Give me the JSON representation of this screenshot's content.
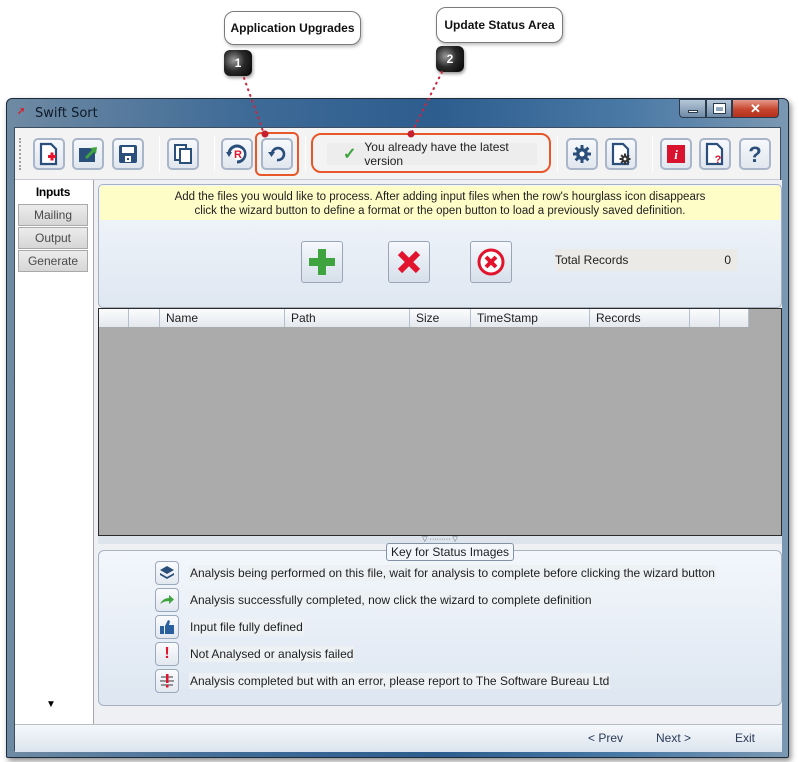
{
  "callouts": [
    {
      "number": "1",
      "label": "Application Upgrades"
    },
    {
      "number": "2",
      "label": "Update Status Area"
    }
  ],
  "window": {
    "title": "Swift Sort",
    "controls": {
      "minimize": "minimize",
      "maximize": "maximize",
      "close": "✕"
    }
  },
  "toolbar": {
    "buttons": [
      {
        "name": "new-definition",
        "icon": "new-file-icon"
      },
      {
        "name": "open-definition",
        "icon": "open-folder-icon"
      },
      {
        "name": "save-definition",
        "icon": "save-icon"
      },
      {
        "name": "copy",
        "icon": "copy-icon"
      },
      {
        "name": "register",
        "icon": "register-icon"
      },
      {
        "name": "check-upgrades",
        "icon": "refresh-icon"
      },
      {
        "name": "settings",
        "icon": "gear-icon"
      },
      {
        "name": "file-settings",
        "icon": "file-gear-icon"
      },
      {
        "name": "info",
        "icon": "info-icon"
      },
      {
        "name": "file-help",
        "icon": "file-question-icon"
      },
      {
        "name": "help",
        "icon": "help-icon"
      }
    ],
    "status_message": "You already have the latest version",
    "status_icon": "✓"
  },
  "tabs": [
    {
      "label": "Inputs",
      "active": true
    },
    {
      "label": "Mailing",
      "active": false
    },
    {
      "label": "Output",
      "active": false
    },
    {
      "label": "Generate",
      "active": false
    }
  ],
  "tabs_scroll_glyph": "▼",
  "inputs": {
    "instructions_line1": "Add the files you would like to process.  After adding input files when the row's hourglass icon disappears",
    "instructions_line2": "click the wizard button to define a format or the open button to load a previously saved definition.",
    "buttons": {
      "add": "add-file",
      "remove": "remove-file",
      "remove_all": "remove-all-files"
    },
    "total_records_label": "Total Records",
    "total_records_value": "0"
  },
  "grid": {
    "columns": [
      "",
      "",
      "Name",
      "Path",
      "Size",
      "TimeStamp",
      "Records",
      "",
      ""
    ],
    "rows": []
  },
  "splitter_glyph": "▽ ········· ▽",
  "key": {
    "title": "Key for Status Images",
    "items": [
      {
        "icon": "layers-icon",
        "text": "Analysis being performed on this file, wait for analysis to complete before clicking the wizard button"
      },
      {
        "icon": "arrow-right-icon",
        "text": "Analysis successfully completed, now click the wizard to complete definition"
      },
      {
        "icon": "thumbs-up-icon",
        "text": "Input file fully defined"
      },
      {
        "icon": "exclamation-icon",
        "text": "Not Analysed or analysis failed"
      },
      {
        "icon": "error-bug-icon",
        "text": "Analysis completed but with an error, please report to The Software Bureau Ltd"
      }
    ]
  },
  "navigation": {
    "prev": "< Prev",
    "next": "Next >",
    "exit": "Exit"
  },
  "colors": {
    "highlight": "#e8572a",
    "callout_line": "#d0243a",
    "info_bar": "#fefdc8",
    "grid_bg": "#ababab"
  }
}
